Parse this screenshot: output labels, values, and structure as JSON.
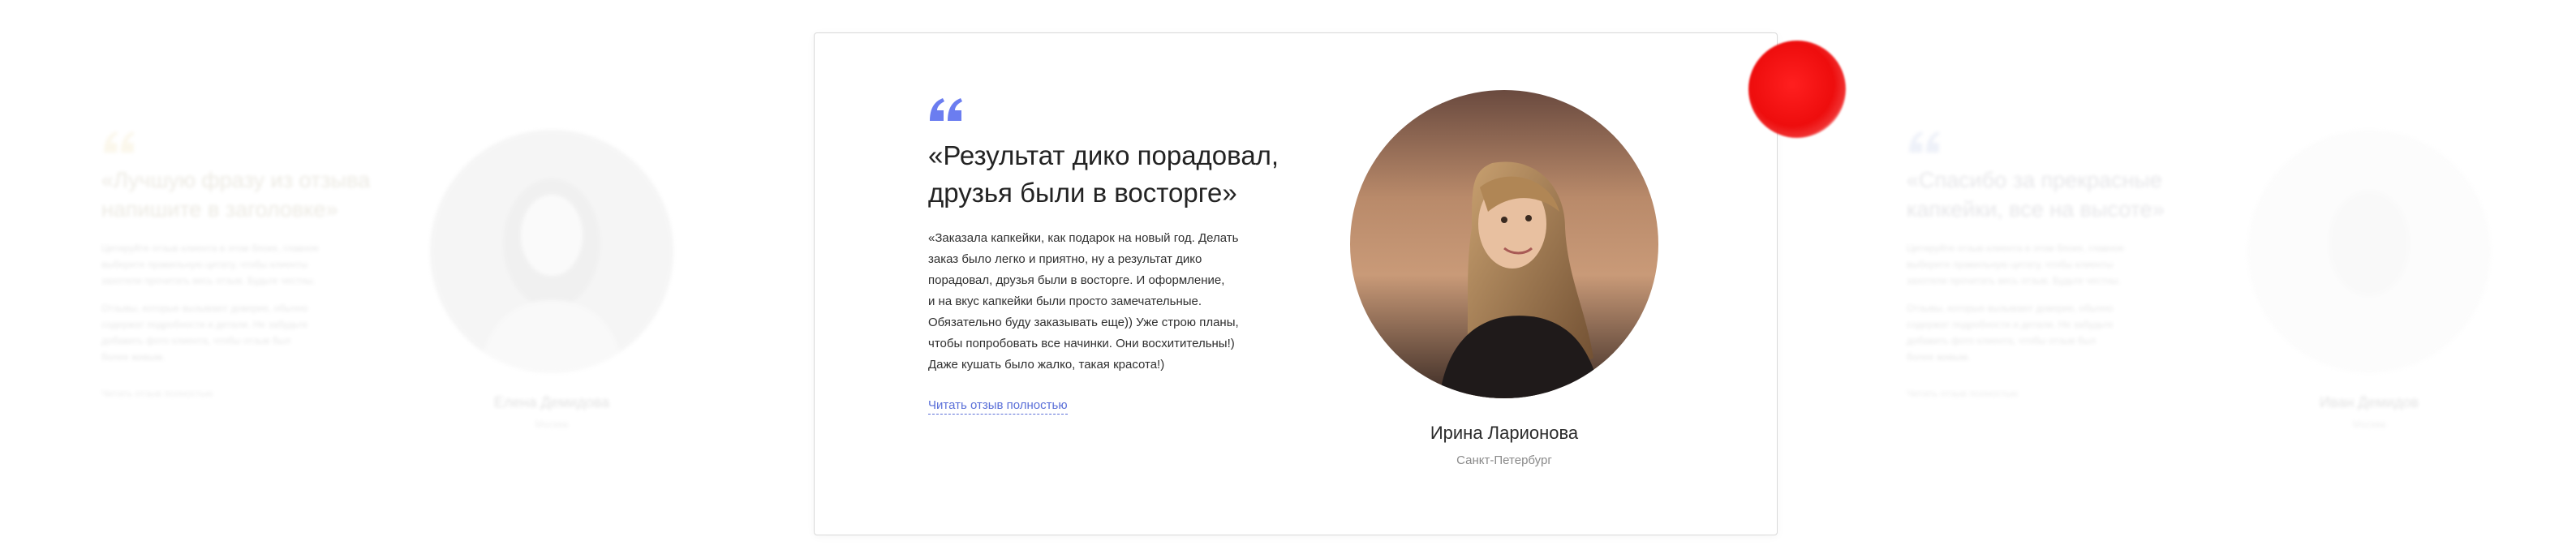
{
  "colors": {
    "accent": "#5a6fd8",
    "quote_mark_active": "#6b7df0",
    "quote_mark_left": "#e3c877",
    "quote_mark_right": "#8a9fd4",
    "red_blob": "#ee0d0d"
  },
  "icons": {
    "quote": "quote-icon",
    "avatar": "avatar-photo"
  },
  "slides": {
    "left": {
      "headline": "«Лучшую фразу из отзыва напишите в заголовке»",
      "body_lines": [
        "Цитируйте отзыв клиента в этом блоке, главное",
        "выберите правильную цитату, чтобы клиенты",
        "захотели прочитать весь отзыв. Будьте честны.",
        "",
        "Отзывы, которые вызывают доверие, обычно",
        "содержат подробности и детали. Не забудьте",
        "добавить фото клиента, чтобы отзыв был",
        "более живым."
      ],
      "more_label": "Читать отзыв полностью",
      "name": "Елена Демидова",
      "city": "Москва"
    },
    "active": {
      "headline": "«Результат дико порадовал, друзья были в восторге»",
      "body_lines": [
        "«Заказала капкейки, как подарок на новый год. Делать",
        "заказ было легко и приятно, ну а результат дико",
        "порадовал, друзья были в восторге. И оформление,",
        "и на вкус капкейки были просто замечательные.",
        "Обязательно буду заказывать еще)) Уже строю планы,",
        "чтобы попробовать все начинки. Они восхитительны!)",
        "Даже кушать было жалко, такая красота!)"
      ],
      "more_label": "Читать отзыв полностью",
      "name": "Ирина Ларионова",
      "city": "Санкт-Петербург"
    },
    "right": {
      "headline": "«Спасибо за прекрасные капкейки, все на высоте»",
      "body_lines": [
        "Цитируйте отзыв клиента в этом блоке, главное",
        "выберите правильную цитату, чтобы клиенты",
        "захотели прочитать весь отзыв. Будьте честны.",
        "",
        "Отзывы, которые вызывают доверие, обычно",
        "содержат подробности и детали. Не забудьте",
        "добавить фото клиента, чтобы отзыв был",
        "более живым."
      ],
      "more_label": "Читать отзыв полностью",
      "name": "Иван Демидов",
      "city": "Москва"
    }
  }
}
